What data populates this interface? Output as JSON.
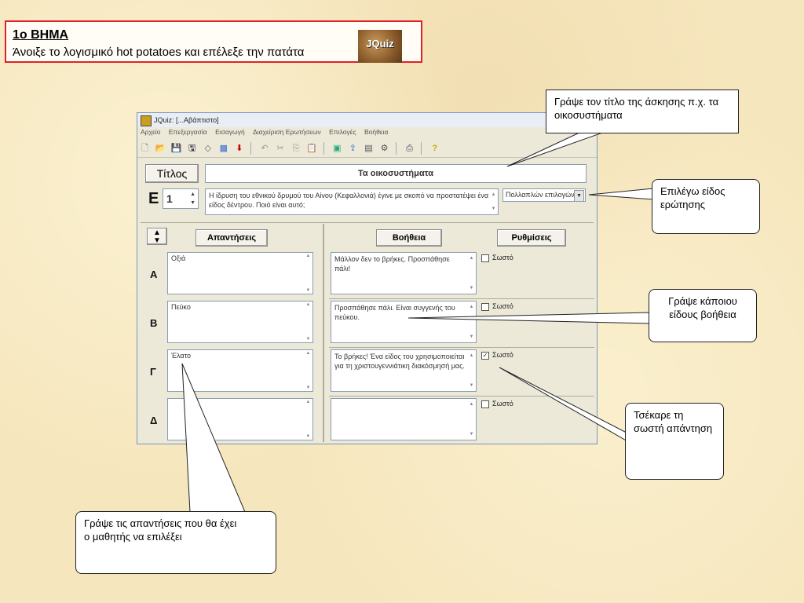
{
  "step": {
    "title": "1ο ΒΗΜΑ",
    "text": "Άνοιξε το λογισμικό hot potatoes και επέλεξε την πατάτα",
    "logo_text": "JQuiz"
  },
  "window": {
    "title": "JQuiz: [...Αβάπτιστο]",
    "menu": [
      "Αρχείο",
      "Επεξεργασία",
      "Εισαγωγή",
      "Διαχείριση Ερωτήσεων",
      "Επιλογές",
      "Βοήθεια"
    ],
    "toolbar_icons": [
      "new-icon",
      "open-icon",
      "save-icon",
      "save-as-icon",
      "eraser-icon",
      "checker-icon",
      "arrow-down-icon",
      "undo-icon",
      "cut-icon",
      "copy-icon",
      "paste-icon",
      "web-icon",
      "export-icon",
      "grid-icon",
      "tools-icon",
      "print-icon",
      "help-icon"
    ],
    "title_label": "Τίτλος",
    "title_value": "Τα οικοσυστήματα",
    "question_label": "E",
    "question_number": "1",
    "question_text": "Η ίδρυση του εθνικού δρυμού του Αίνου (Κεφαλλονιά) έγινε με σκοπό να προστατέψει ένα είδος δέντρου. Ποιό είναι αυτό;",
    "question_type": "Πολλαπλών επιλογών",
    "answers_header": "Απαντήσεις",
    "feedback_header": "Βοήθεια",
    "settings_header": "Ρυθμίσεις",
    "correct_label": "Σωστό",
    "rows": [
      {
        "letter": "Α",
        "answer": "Οξιά",
        "feedback": "Μάλλον δεν το βρήκες. Προσπάθησε πάλι!",
        "checked": false
      },
      {
        "letter": "Β",
        "answer": "Πεύκο",
        "feedback": "Προσπάθησε πάλι. Είναι συγγενής του πεύκου.",
        "checked": false
      },
      {
        "letter": "Γ",
        "answer": "Έλατο",
        "feedback": "Το βρήκες! Ένα είδος του χρησιμοποιείται για τη χριστουγεννιάτικη διακόσμησή μας.",
        "checked": true
      },
      {
        "letter": "Δ",
        "answer": "",
        "feedback": "",
        "checked": false
      }
    ]
  },
  "callouts": {
    "title_hint": "Γράψε τον τίτλο της άσκησης π.χ. τα οικοσυστήματα",
    "type_hint": "Επιλέγω είδος ερώτησης",
    "feedback_hint": "Γράψε κάποιου είδους βοήθεια",
    "correct_hint": "Τσέκαρε τη σωστή απάντηση",
    "answers_hint_1": "Γράψε τις απαντήσεις που θα έχει",
    "answers_hint_2": "ο  μαθητής να επιλέξει"
  },
  "colors": {
    "step_border": "#e0202a",
    "background": "#f6e6bd"
  }
}
